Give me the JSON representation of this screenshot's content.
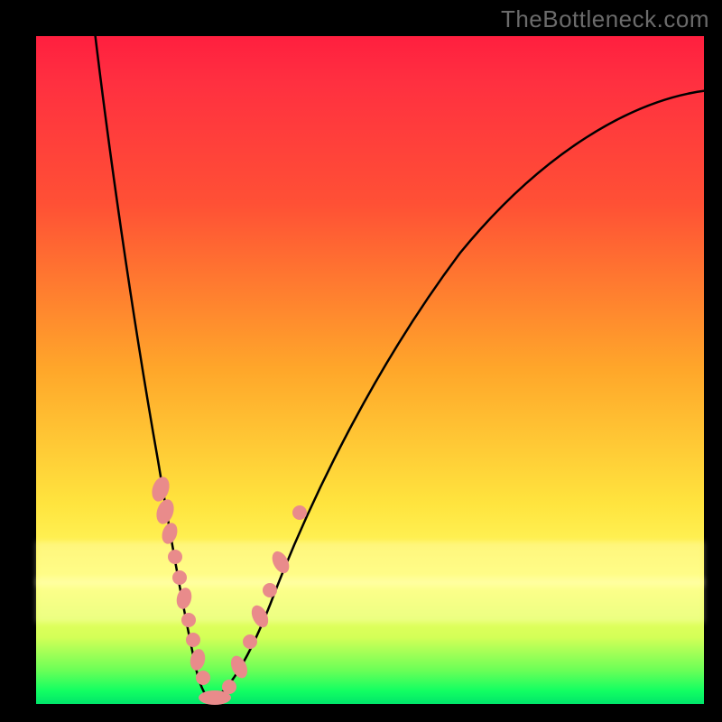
{
  "watermark": "TheBottleneck.com",
  "colors": {
    "frame": "#000000",
    "gradient_top": "#ff1f3f",
    "gradient_mid1": "#ffa72a",
    "gradient_mid2": "#ffe43e",
    "gradient_bottom": "#00e56a",
    "curve": "#000000",
    "beads": "#e98b8b"
  },
  "chart_data": {
    "type": "line",
    "title": "",
    "xlabel": "",
    "ylabel": "",
    "xlim": [
      0,
      100
    ],
    "ylim": [
      0,
      100
    ],
    "grid": false,
    "legend": false,
    "series": [
      {
        "name": "left-branch",
        "x": [
          10,
          11,
          12,
          13,
          14,
          15,
          16,
          17,
          18,
          19,
          20,
          21,
          22,
          23,
          24,
          25
        ],
        "y": [
          100,
          92,
          84,
          76,
          68,
          60,
          52,
          44,
          36,
          28,
          21,
          15,
          10,
          6,
          3,
          0
        ]
      },
      {
        "name": "right-branch",
        "x": [
          25,
          27,
          30,
          34,
          38,
          43,
          49,
          56,
          64,
          73,
          83,
          94,
          100
        ],
        "y": [
          0,
          3,
          8,
          16,
          24,
          33,
          42,
          52,
          62,
          72,
          81,
          88,
          91
        ]
      }
    ],
    "markers": {
      "name": "beads",
      "note": "salmon markers clustered near the trough of the V",
      "x": [
        18.5,
        19.3,
        20.0,
        20.8,
        21.4,
        22.0,
        22.6,
        23.2,
        23.8,
        24.5,
        25.2,
        26.0,
        27.0,
        28.0,
        29.2,
        30.5,
        32.0,
        34.0
      ],
      "y": [
        30,
        27,
        23,
        20,
        17,
        14,
        11,
        9,
        7,
        5,
        3.5,
        2.5,
        2,
        2.5,
        4,
        7,
        12,
        22
      ]
    }
  }
}
